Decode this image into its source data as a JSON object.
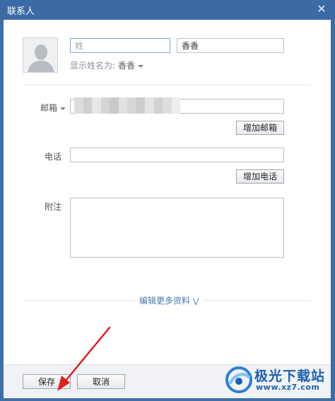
{
  "window": {
    "title": "联系人",
    "close_glyph": "✕"
  },
  "name": {
    "surname_placeholder": "姓",
    "given_name_value": "香香",
    "display_name_label": "显示姓名为:",
    "display_name_value": "香香"
  },
  "email": {
    "label": "邮箱",
    "value": "",
    "add_button": "增加邮箱"
  },
  "phone": {
    "label": "电话",
    "value": "",
    "add_button": "增加电话"
  },
  "note": {
    "label": "附注",
    "value": ""
  },
  "more_link": "编辑更多资料",
  "footer": {
    "save_button": "保存",
    "cancel_button": "取消"
  },
  "watermark": {
    "title": "极光下载站",
    "url": "www.xz7.com"
  },
  "colors": {
    "titlebar": "#3c6aa5",
    "link": "#4a78b3",
    "annotation_arrow": "#e02020",
    "watermark": "#1b5fae"
  },
  "icons": {
    "avatar": "default-avatar-icon",
    "close": "close-icon",
    "dropdown": "caret-down-icon",
    "expand": "double-chevron-down-icon"
  }
}
